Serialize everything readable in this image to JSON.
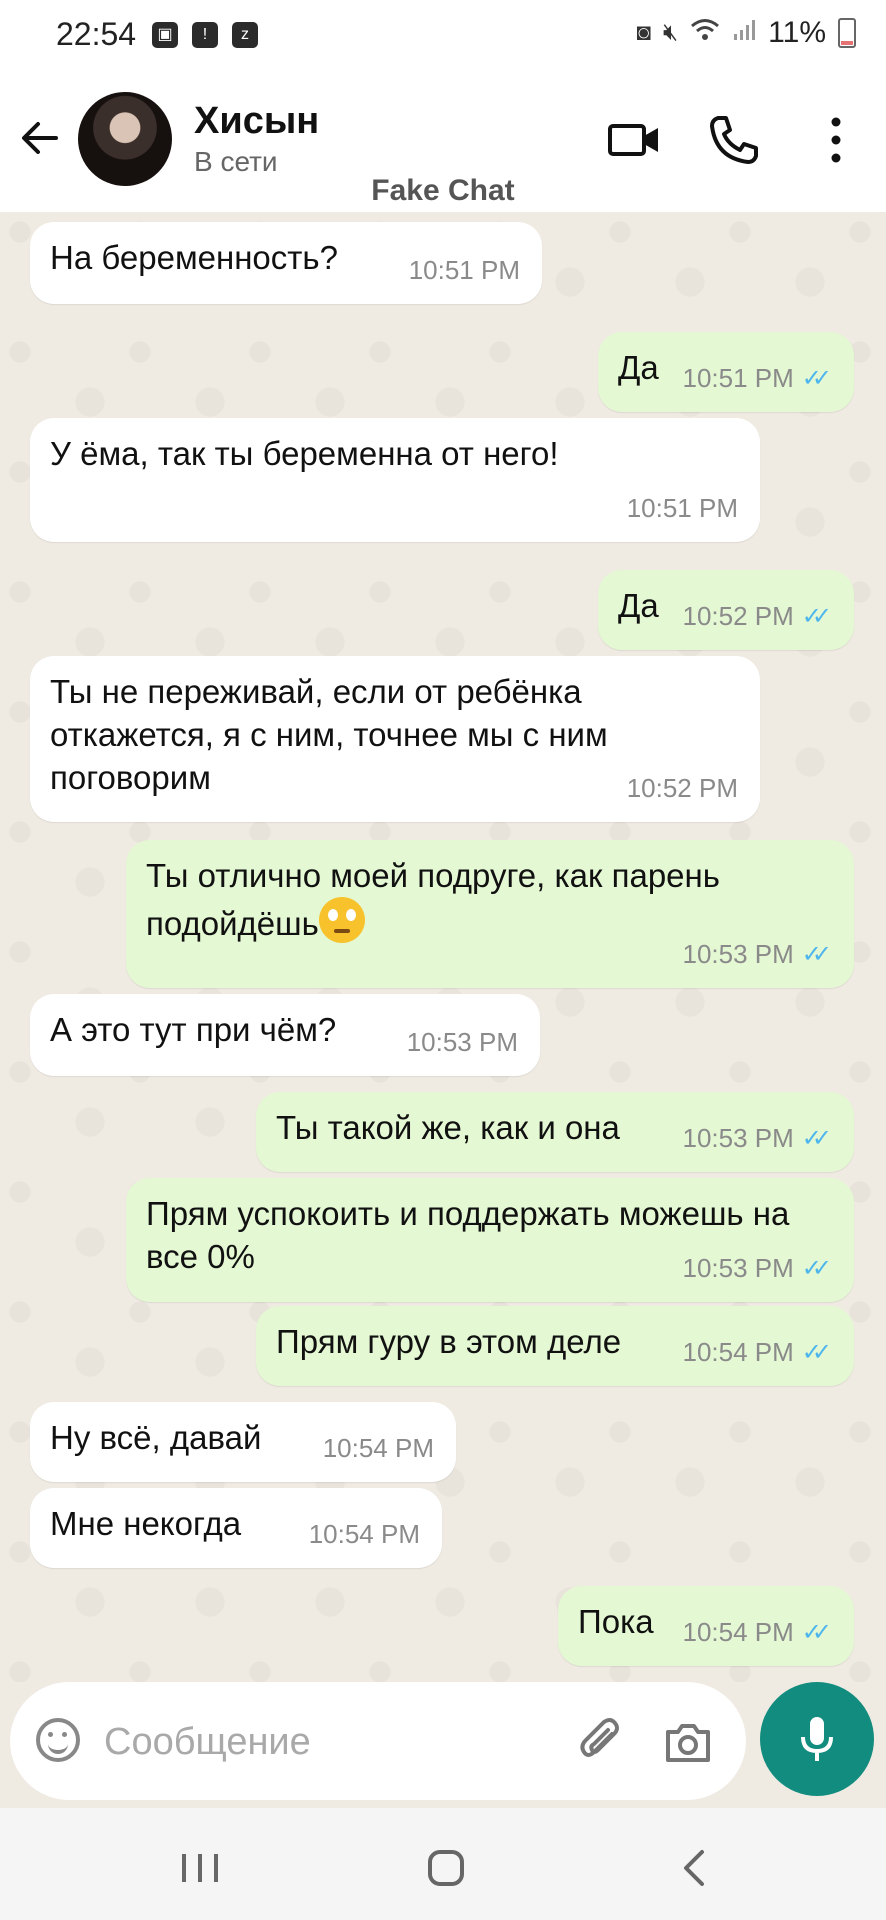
{
  "status_bar": {
    "time": "22:54",
    "battery": "11%"
  },
  "header": {
    "back_icon": "arrow-left-icon",
    "contact_name": "Хисын",
    "contact_status": "В сети",
    "video_icon": "video-camera-icon",
    "call_icon": "phone-icon",
    "menu_icon": "more-vert-icon"
  },
  "watermark": "Fake Chat",
  "messages": [
    {
      "direction": "in",
      "text": "На беременность?",
      "time": "10:51 PM"
    },
    {
      "direction": "out",
      "text": "Да",
      "time": "10:51 PM"
    },
    {
      "direction": "in",
      "text": "У ёма, так ты беременна от него!",
      "time": "10:51 PM"
    },
    {
      "direction": "out",
      "text": "Да",
      "time": "10:52 PM"
    },
    {
      "direction": "in",
      "text": "Ты не переживай, если от ребёнка откажется, я с ним, точнее мы с ним поговорим",
      "time": "10:52 PM"
    },
    {
      "direction": "out",
      "text": "Ты отлично моей подруге, как парень подойдёшь",
      "time": "10:53 PM",
      "emoji": "face-with-rolling-eyes"
    },
    {
      "direction": "in",
      "text": "А это тут при чём?",
      "time": "10:53 PM"
    },
    {
      "direction": "out",
      "text": "Ты такой же, как и она",
      "time": "10:53 PM"
    },
    {
      "direction": "out",
      "text": "Прям успокоить и поддержать можешь на все 0%",
      "time": "10:53 PM"
    },
    {
      "direction": "out",
      "text": "Прям гуру в этом деле",
      "time": "10:54 PM"
    },
    {
      "direction": "in",
      "text": "Ну всё, давай",
      "time": "10:54 PM"
    },
    {
      "direction": "in",
      "text": "Мне некогда",
      "time": "10:54 PM"
    },
    {
      "direction": "out",
      "text": "Пока",
      "time": "10:54 PM"
    }
  ],
  "composer": {
    "placeholder": "Сообщение",
    "emoji_icon": "emoji-icon",
    "attach_icon": "paperclip-icon",
    "camera_icon": "camera-icon",
    "mic_icon": "microphone-icon"
  },
  "colors": {
    "accent": "#128c7e",
    "outgoing_bubble": "#e4f8d3",
    "incoming_bubble": "#ffffff",
    "read_ticks": "#4fb6ec"
  }
}
